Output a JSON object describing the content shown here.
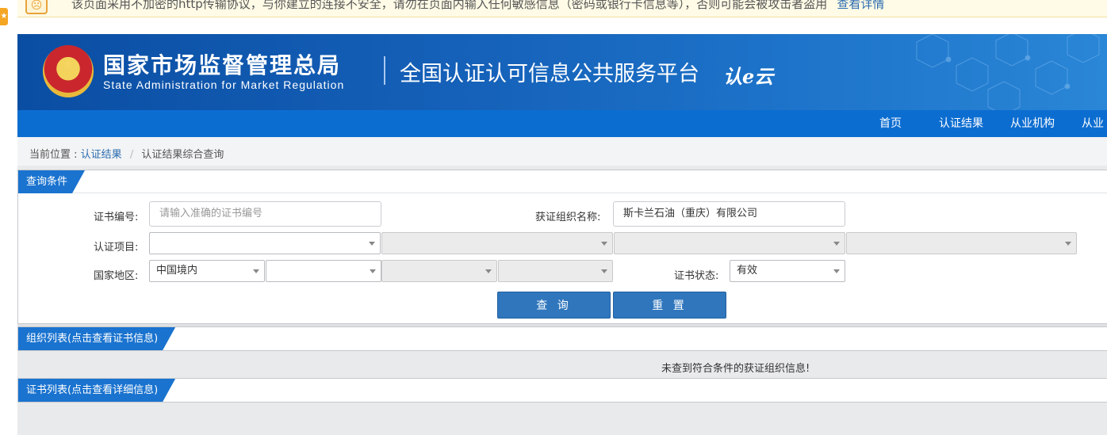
{
  "warning": {
    "text": "该页面采用不加密的http传输协议，与你建立的连接不安全，请勿在页面内输入任何敏感信息（密码或银行卡信息等），否则可能会被攻击者盗用",
    "link": "查看详情"
  },
  "header": {
    "org_cn": "国家市场监督管理总局",
    "org_en": "State Administration  for  Market Regulation",
    "platform": "全国认证认可信息公共服务平台",
    "logo_text": "认e云"
  },
  "nav": {
    "items": [
      "首页",
      "认证结果",
      "从业机构",
      "从业"
    ]
  },
  "breadcrumb": {
    "prefix": "当前位置 :",
    "level1": "认证结果",
    "separator": "/",
    "level2": "认证结果综合查询"
  },
  "query": {
    "tab": "查询条件",
    "cert_no_label": "证书编号:",
    "cert_no_placeholder": "请输入准确的证书编号",
    "org_name_label": "获证组织名称:",
    "org_name_value": "斯卡兰石油（重庆）有限公司",
    "project_label": "认证项目:",
    "region_label": "国家地区:",
    "region_value": "中国境内",
    "status_label": "证书状态:",
    "status_value": "有效",
    "search_btn": "查 询",
    "reset_btn": "重 置"
  },
  "org_list": {
    "tab": "组织列表(点击查看证书信息)",
    "empty": "未查到符合条件的获证组织信息!"
  },
  "cert_list": {
    "tab": "证书列表(点击查看详细信息)"
  },
  "colors": {
    "nav_blue": "#0c6dd1",
    "tab_blue": "#1a73cf",
    "button_blue": "#2f76bd",
    "link_blue": "#2b6cb0"
  }
}
